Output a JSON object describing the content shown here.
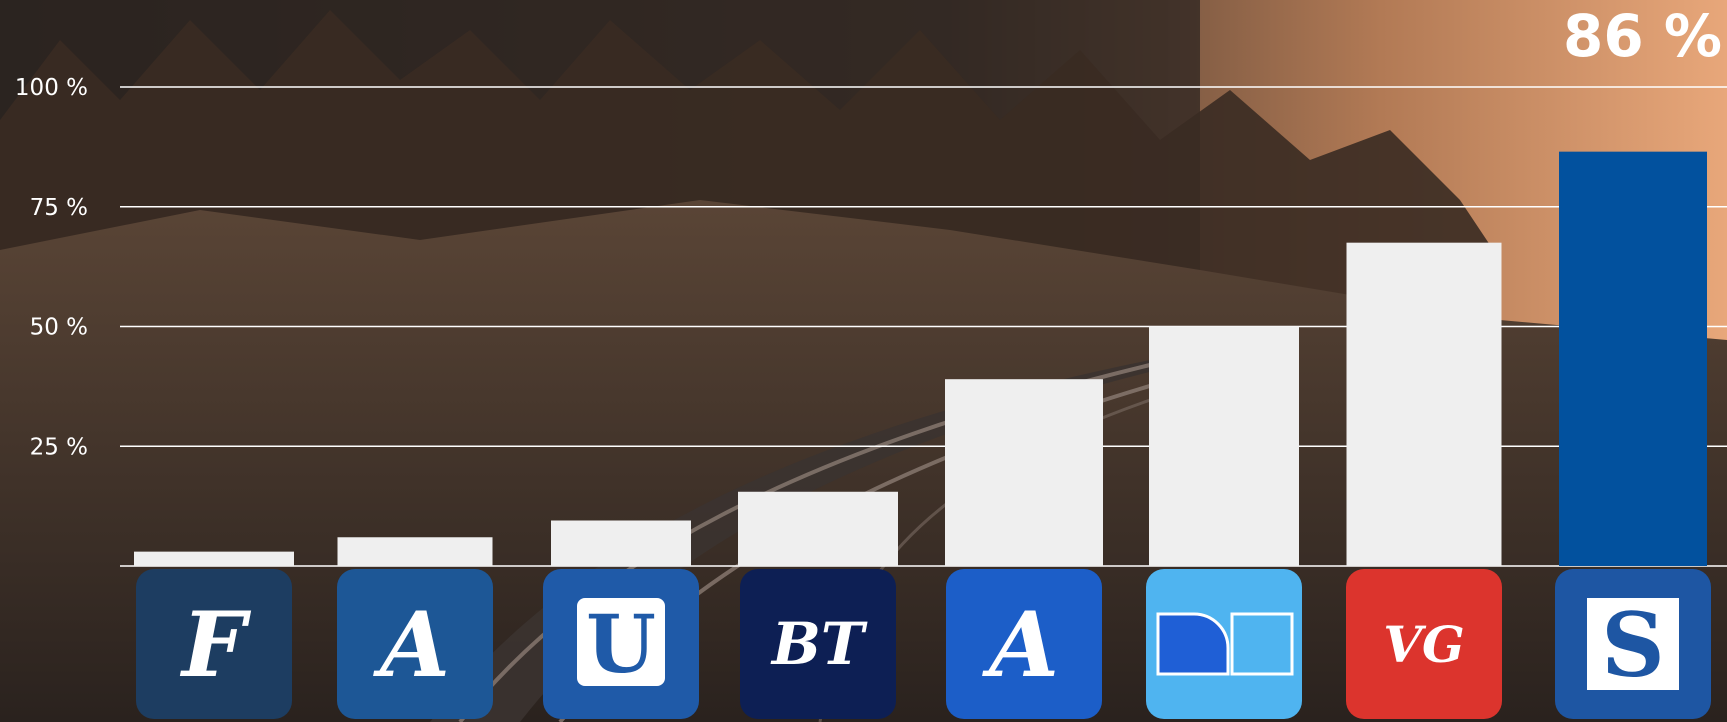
{
  "chart_data": {
    "type": "bar",
    "categories": [
      "F",
      "A",
      "U",
      "BT",
      "A",
      "D",
      "VG",
      "S"
    ],
    "values": [
      3,
      6,
      9.5,
      15.5,
      39,
      50,
      67.5,
      86.5
    ],
    "highlight": {
      "index": 7,
      "label": "86 %"
    },
    "ylim": [
      0,
      100
    ],
    "yticks": [
      {
        "value": 25,
        "label": "25 %"
      },
      {
        "value": 50,
        "label": "50 %"
      },
      {
        "value": 75,
        "label": "75 %"
      },
      {
        "value": 100,
        "label": "100 %"
      }
    ],
    "grid": true,
    "colors": {
      "bar": "#efefef",
      "highlight_bar": "#02519e",
      "grid": "#ffffff"
    },
    "logos": [
      {
        "icon": "fedrelandsvennen-logo-icon",
        "text": "F",
        "bg": "#1d3d61"
      },
      {
        "icon": "aftenposten-logo-icon",
        "text": "A",
        "bg": "#1d5796"
      },
      {
        "icon": "adresseavisen-logo-icon",
        "text": "U",
        "bg": "#1f5aa8"
      },
      {
        "icon": "bergens-tidende-logo-icon",
        "text": "BT",
        "bg": "#0d1f54"
      },
      {
        "icon": "aftenbladet-logo-icon",
        "text": "A",
        "bg": "#1c5ec8"
      },
      {
        "icon": "dagbladet-logo-icon",
        "text": "",
        "bg": "#4fb4f0"
      },
      {
        "icon": "vg-logo-icon",
        "text": "VG",
        "bg": "#dc342d"
      },
      {
        "icon": "stavanger-logo-icon",
        "text": "S",
        "bg": "#1e56a3"
      }
    ]
  }
}
